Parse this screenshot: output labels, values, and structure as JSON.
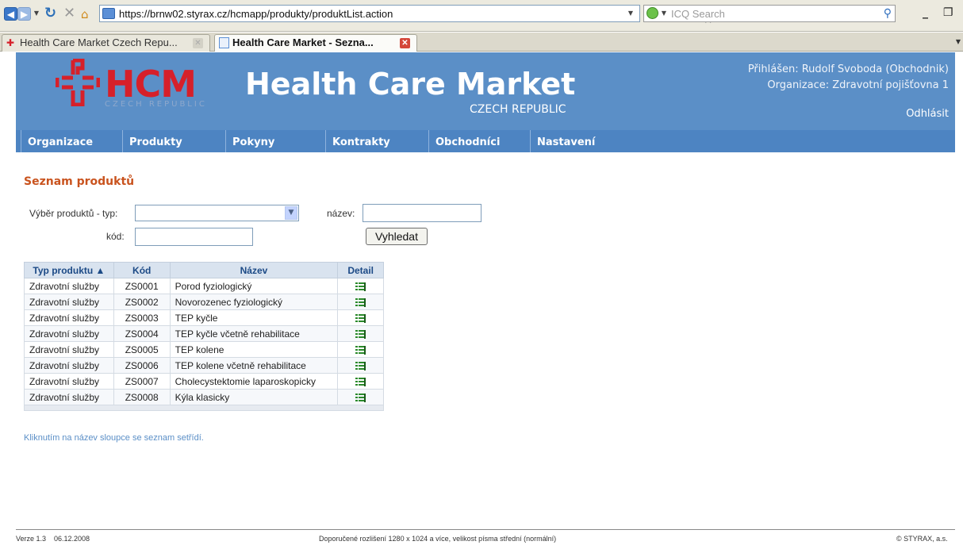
{
  "browser": {
    "url": "https://brnw02.styrax.cz/hcmapp/produkty/produktList.action",
    "search_placeholder": "ICQ Search",
    "tabs": [
      {
        "label": "Health Care Market Czech Repu...",
        "active": false
      },
      {
        "label": "Health Care Market - Sezna...",
        "active": true
      }
    ]
  },
  "header": {
    "logo_text": "HCM",
    "logo_sub": "CZECH REPUBLIC",
    "title": "Health Care Market",
    "subtitle": "CZECH REPUBLIC",
    "user_line": "Přihlášen: Rudolf Svoboda (Obchodnik)",
    "org_line": "Organizace: Zdravotní pojišťovna 1",
    "logout": "Odhlásit",
    "brand_color": "#5b8fc7",
    "logo_color": "#d6202a"
  },
  "menu": [
    "Organizace",
    "Produkty",
    "Pokyny",
    "Kontrakty",
    "Obchodníci",
    "Nastavení"
  ],
  "page": {
    "heading": "Seznam produktů",
    "filter": {
      "type_label": "Výběr produktů - typ:",
      "type_value": "",
      "name_label": "název:",
      "name_value": "",
      "code_label": "kód:",
      "code_value": "",
      "search_button": "Vyhledat"
    },
    "table": {
      "columns": [
        "Typ produktu ▲",
        "Kód",
        "Název",
        "Detail"
      ],
      "rows": [
        [
          "Zdravotní služby",
          "ZS0001",
          "Porod fyziologický"
        ],
        [
          "Zdravotní služby",
          "ZS0002",
          "Novorozenec fyziologický"
        ],
        [
          "Zdravotní služby",
          "ZS0003",
          "TEP kyčle"
        ],
        [
          "Zdravotní služby",
          "ZS0004",
          "TEP kyčle včetně rehabilitace"
        ],
        [
          "Zdravotní služby",
          "ZS0005",
          "TEP kolene"
        ],
        [
          "Zdravotní služby",
          "ZS0006",
          "TEP kolene včetně rehabilitace"
        ],
        [
          "Zdravotní služby",
          "ZS0007",
          "Cholecystektomie laparoskopicky"
        ],
        [
          "Zdravotní služby",
          "ZS0008",
          "Kýla klasicky"
        ]
      ],
      "detail_icon": "detail-list-icon"
    },
    "hint": "Kliknutím na název sloupce se seznam setřídí."
  },
  "footer": {
    "version": "Verze 1.3",
    "date": "06.12.2008",
    "recommendation": "Doporučené rozlišení 1280 x 1024 a více, velikost písma střední (normální)",
    "copyright": "© STYRAX, a.s."
  }
}
